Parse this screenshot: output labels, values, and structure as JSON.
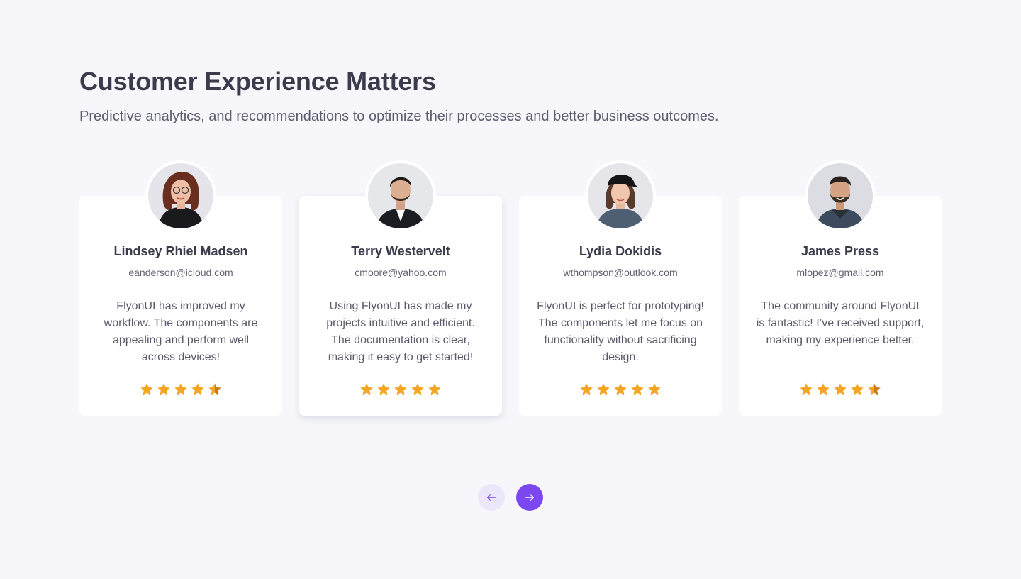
{
  "section": {
    "title": "Customer Experience Matters",
    "subtitle": "Predictive analytics, and recommendations to optimize their processes and better business outcomes."
  },
  "testimonials": [
    {
      "name": "Lindsey Rhiel Madsen",
      "email": "eanderson@icloud.com",
      "quote": "FlyonUI has improved my workflow. The components are appealing and perform well across devices!",
      "rating": 4.5
    },
    {
      "name": "Terry Westervelt",
      "email": "cmoore@yahoo.com",
      "quote": "Using FlyonUI has made my projects intuitive and efficient. The documentation is clear, making it easy to get started!",
      "rating": 5
    },
    {
      "name": "Lydia Dokidis",
      "email": "wthompson@outlook.com",
      "quote": "FlyonUI is perfect for prototyping! The components let me focus on functionality without sacrificing design.",
      "rating": 5
    },
    {
      "name": "James Press",
      "email": "mlopez@gmail.com",
      "quote": "The community around FlyonUI is fantastic! I’ve received support, making my experience better.",
      "rating": 4.5
    }
  ],
  "carousel": {
    "prev_icon": "arrow-left-icon",
    "next_icon": "arrow-right-icon"
  },
  "colors": {
    "background": "#f6f6fb",
    "star": "#f5a524",
    "star_half": "#c97b1c",
    "accent": "#7b47f0",
    "accent_soft": "#ece6fb"
  }
}
